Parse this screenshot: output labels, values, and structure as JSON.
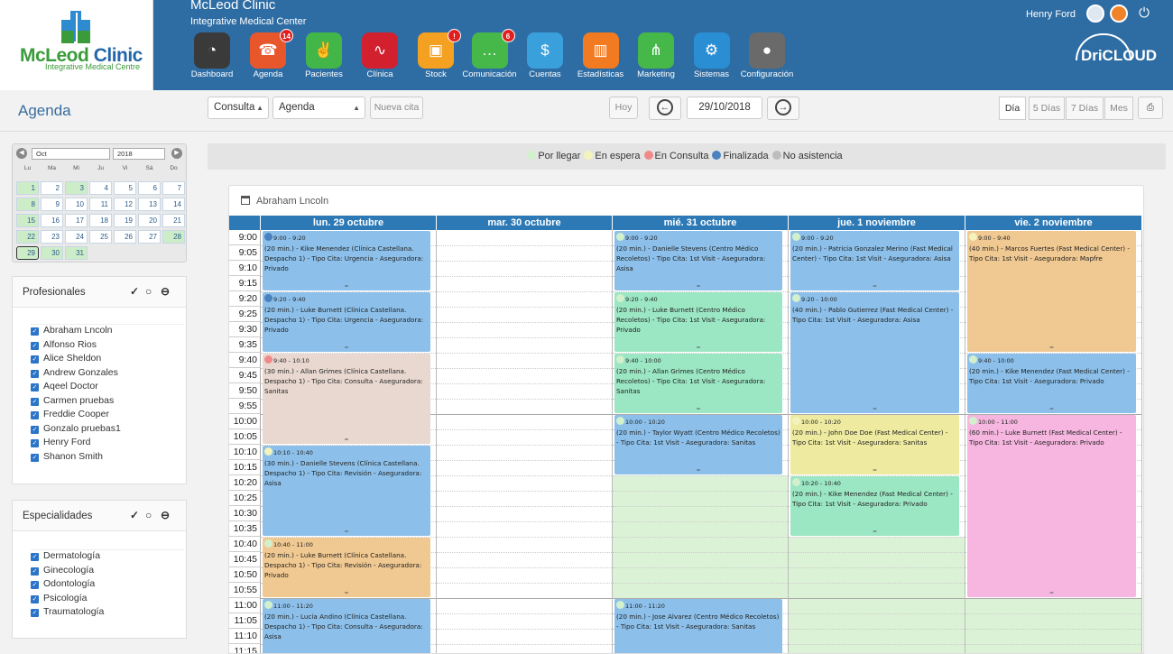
{
  "header": {
    "clinic_name": "McLeod Clinic",
    "clinic_subtitle": "Integrative Medical Center",
    "logo_text_a": "McLeod",
    "logo_text_b": "Clinic",
    "logo_sub": "Integrative Medical Centre",
    "user_name": "Henry Ford",
    "brand": "DriCLOUD",
    "apps": [
      {
        "label": "Dashboard",
        "icon": "dashboard-icon",
        "color": "#3a3a3a",
        "badge": ""
      },
      {
        "label": "Agenda",
        "icon": "agenda-icon",
        "color": "#e8572c",
        "badge": "14"
      },
      {
        "label": "Pacientes",
        "icon": "patients-icon",
        "color": "#43b649",
        "badge": ""
      },
      {
        "label": "Clínica",
        "icon": "clinic-icon",
        "color": "#d2202f",
        "badge": ""
      },
      {
        "label": "Stock",
        "icon": "stock-icon",
        "color": "#f4a020",
        "badge": "!"
      },
      {
        "label": "Comunicación",
        "icon": "communication-icon",
        "color": "#46b84a",
        "badge": "6"
      },
      {
        "label": "Cuentas",
        "icon": "accounts-icon",
        "color": "#3aa0dc",
        "badge": ""
      },
      {
        "label": "Estadísticas",
        "icon": "statistics-icon",
        "color": "#f27a20",
        "badge": ""
      },
      {
        "label": "Marketing",
        "icon": "marketing-icon",
        "color": "#46b84a",
        "badge": ""
      },
      {
        "label": "Sistemas",
        "icon": "systems-icon",
        "color": "#2a8ed4",
        "badge": ""
      },
      {
        "label": "Configuración",
        "icon": "settings-icon",
        "color": "#6a6a6a",
        "badge": ""
      }
    ]
  },
  "toolbar": {
    "page_title": "Agenda",
    "consulta": "Consulta",
    "agenda": "Agenda",
    "new_appt": "Nueva cita",
    "today": "Hoy",
    "date": "29/10/2018",
    "views": [
      "Día",
      "5 Días",
      "7 Días",
      "Mes"
    ],
    "active_view": "5 Días"
  },
  "minical": {
    "month": "Oct",
    "year": "2018",
    "weekdays": [
      "Lu",
      "Ma",
      "Mi",
      "Ju",
      "Vi",
      "Sá",
      "Do"
    ],
    "days": [
      [
        "1",
        "2",
        "3",
        "4",
        "5",
        "6",
        "7"
      ],
      [
        "8",
        "9",
        "10",
        "11",
        "12",
        "13",
        "14"
      ],
      [
        "15",
        "16",
        "17",
        "18",
        "19",
        "20",
        "21"
      ],
      [
        "22",
        "23",
        "24",
        "25",
        "26",
        "27",
        "28"
      ],
      [
        "29",
        "30",
        "31"
      ]
    ],
    "green": [
      "1",
      "3",
      "8",
      "15",
      "22",
      "28",
      "29",
      "30",
      "31"
    ],
    "selected": "29"
  },
  "profesionales": {
    "title": "Profesionales",
    "items": [
      "Abraham Lncoln",
      "Alfonso Rios",
      "Alice Sheldon",
      "Andrew Gonzales",
      "Aqeel Doctor",
      "Carmen pruebas",
      "Freddie Cooper",
      "Gonzalo pruebas1",
      "Henry Ford",
      "Shanon Smith"
    ]
  },
  "especialidades": {
    "title": "Especialidades",
    "items": [
      "Dermatología",
      "Ginecología",
      "Odontología",
      "Psicología",
      "Traumatología"
    ]
  },
  "legend": [
    {
      "label": "Por llegar",
      "color": "#d2f0cc"
    },
    {
      "label": "En espera",
      "color": "#f3f3bb"
    },
    {
      "label": "En Consulta",
      "color": "#f08a8a"
    },
    {
      "label": "Finalizada",
      "color": "#4a82c0"
    },
    {
      "label": "No asistencia",
      "color": "#bdbdbd"
    }
  ],
  "calendar": {
    "professional": "Abraham Lncoln",
    "days": [
      "lun. 29 octubre",
      "mar. 30 octubre",
      "mié. 31 octubre",
      "jue. 1 noviembre",
      "vie. 2 noviembre"
    ],
    "times": [
      "9:00",
      "9:05",
      "9:10",
      "9:15",
      "9:20",
      "9:25",
      "9:30",
      "9:35",
      "9:40",
      "9:45",
      "9:50",
      "9:55",
      "10:00",
      "10:05",
      "10:10",
      "10:15",
      "10:20",
      "10:25",
      "10:30",
      "10:35",
      "10:40",
      "10:45",
      "10:50",
      "10:55",
      "11:00",
      "11:05",
      "11:10",
      "11:15"
    ],
    "appointments": [
      {
        "day": 0,
        "start": 0,
        "slots": 4,
        "cls": "bl",
        "dot": "#4a82c0",
        "time": "9:00 - 9:20",
        "text": "(20 min.) - Kike Menendez (Clínica Castellana. Despacho 1) - Tipo Cita: Urgencia - Aseguradora: Privado"
      },
      {
        "day": 0,
        "start": 4,
        "slots": 4,
        "cls": "bl",
        "dot": "#4a82c0",
        "time": "9:20 - 9:40",
        "text": "(20 min.) - Luke Burnett (Clínica Castellana. Despacho 1) - Tipo Cita: Urgencia - Aseguradora: Privado"
      },
      {
        "day": 0,
        "start": 8,
        "slots": 6,
        "cls": "rs",
        "dot": "#f08a8a",
        "time": "9:40 - 10:10",
        "text": "(30 min.) - Allan Grimes (Clínica Castellana. Despacho 1) - Tipo Cita: Consulta - Aseguradora: Sanitas"
      },
      {
        "day": 0,
        "start": 14,
        "slots": 6,
        "cls": "bl",
        "dot": "#f3f3bb",
        "time": "10:10 - 10:40",
        "text": "(30 min.) - Danielle Stevens (Clínica Castellana. Despacho 1) - Tipo Cita: Revisión - Aseguradora: Asisa"
      },
      {
        "day": 0,
        "start": 20,
        "slots": 4,
        "cls": "or",
        "dot": "#d2f0cc",
        "time": "10:40 - 11:00",
        "text": "(20 min.) - Luke Burnett (Clínica Castellana. Despacho 1) - Tipo Cita: Revisión - Aseguradora: Privado"
      },
      {
        "day": 0,
        "start": 24,
        "slots": 4,
        "cls": "bl",
        "dot": "#d2f0cc",
        "time": "11:00 - 11:20",
        "text": "(20 min.) - Lucía Andino (Clínica Castellana. Despacho 1) - Tipo Cita: Consulta - Aseguradora: Asisa"
      },
      {
        "day": 2,
        "start": 0,
        "slots": 4,
        "cls": "bl",
        "dot": "#d2f0cc",
        "time": "9:00 - 9:20",
        "text": "(20 min.) - Danielle Stevens (Centro Médico Recoletos) - Tipo Cita: 1st Visit - Aseguradora: Asisa"
      },
      {
        "day": 2,
        "start": 4,
        "slots": 4,
        "cls": "gr",
        "dot": "#d2f0cc",
        "time": "9:20 - 9:40",
        "text": "(20 min.) - Luke Burnett (Centro Médico Recoletos) - Tipo Cita: 1st Visit - Aseguradora: Privado"
      },
      {
        "day": 2,
        "start": 8,
        "slots": 4,
        "cls": "gr",
        "dot": "#d2f0cc",
        "time": "9:40 - 10:00",
        "text": "(20 min.) - Allan Grimes (Centro Médico Recoletos) - Tipo Cita: 1st Visit - Aseguradora: Sanitas"
      },
      {
        "day": 2,
        "start": 12,
        "slots": 4,
        "cls": "bl",
        "dot": "#d2f0cc",
        "time": "10:00 - 10:20",
        "text": "(20 min.) - Taylor Wyatt (Centro Médico Recoletos) - Tipo Cita: 1st Visit - Aseguradora: Sanitas"
      },
      {
        "day": 2,
        "start": 24,
        "slots": 4,
        "cls": "bl",
        "dot": "#d2f0cc",
        "time": "11:00 - 11:20",
        "text": "(20 min.) - Jose Alvarez (Centro Médico Recoletos) - Tipo Cita: 1st Visit - Aseguradora: Sanitas"
      },
      {
        "day": 3,
        "start": 0,
        "slots": 4,
        "cls": "bl",
        "dot": "#d2f0cc",
        "time": "9:00 - 9:20",
        "text": "(20 min.) - Patricia Gonzalez Merino (Fast Medical Center) - Tipo Cita: 1st Visit - Aseguradora: Asisa"
      },
      {
        "day": 3,
        "start": 4,
        "slots": 8,
        "cls": "bl",
        "dot": "#d2f0cc",
        "time": "9:20 - 10:00",
        "text": "(40 min.) - Pablo Gutierrez (Fast Medical Center) - Tipo Cita: 1st Visit - Aseguradora: Asisa"
      },
      {
        "day": 3,
        "start": 12,
        "slots": 4,
        "cls": "ye",
        "dot": "#f3f3bb",
        "time": "10:00 - 10:20",
        "text": "(20 min.) - John Doe Doe (Fast Medical Center) - Tipo Cita: 1st Visit - Aseguradora: Sanitas"
      },
      {
        "day": 3,
        "start": 16,
        "slots": 4,
        "cls": "gr",
        "dot": "#d2f0cc",
        "time": "10:20 - 10:40",
        "text": "(20 min.) - Kike Menendez (Fast Medical Center) - Tipo Cita: 1st Visit - Aseguradora: Privado"
      },
      {
        "day": 4,
        "start": 0,
        "slots": 8,
        "cls": "or",
        "dot": "#f3f3bb",
        "time": "9:00 - 9:40",
        "text": "(40 min.) - Marcos Fuertes (Fast Medical Center) - Tipo Cita: 1st Visit - Aseguradora: Mapfre"
      },
      {
        "day": 4,
        "start": 8,
        "slots": 4,
        "cls": "bl",
        "dot": "#d2f0cc",
        "time": "9:40 - 10:00",
        "text": "(20 min.) - Kike Menendez (Fast Medical Center) - Tipo Cita: 1st Visit - Aseguradora: Privado"
      },
      {
        "day": 4,
        "start": 12,
        "slots": 12,
        "cls": "pk",
        "dot": "#d2f0cc",
        "time": "10:00 - 11:00",
        "text": "(60 min.) - Luke Burnett (Fast Medical Center) - Tipo Cita: 1st Visit - Aseguradora: Privado"
      }
    ],
    "free_green": [
      {
        "day": 2,
        "start": 16,
        "slots": 8
      },
      {
        "day": 2,
        "start": 28,
        "slots": 1
      },
      {
        "day": 3,
        "start": 20,
        "slots": 8
      },
      {
        "day": 4,
        "start": 24,
        "slots": 4
      }
    ]
  }
}
